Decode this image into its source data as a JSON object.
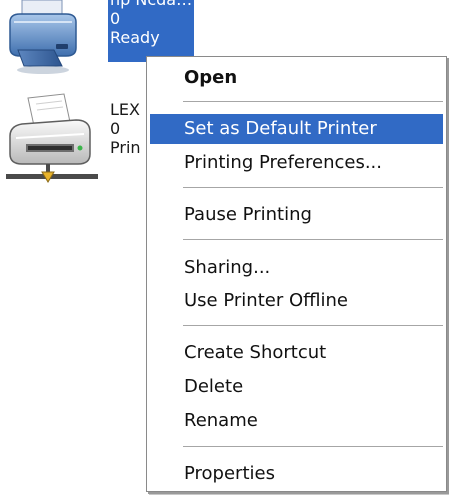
{
  "printers": [
    {
      "name": "hp Ncdá…",
      "jobs": "0",
      "status": "Ready",
      "selected": true,
      "icon": "printer-icon"
    },
    {
      "name": "LEX",
      "jobs": "0",
      "status": "Prin",
      "selected": false,
      "icon": "shared-printer-icon"
    }
  ],
  "menu": {
    "items": [
      {
        "label": "Open",
        "bold": true
      },
      {
        "label": "Set as Default Printer",
        "highlighted": true
      },
      {
        "label": "Printing Preferences..."
      },
      {
        "label": "Pause Printing"
      },
      {
        "label": "Sharing..."
      },
      {
        "label": "Use Printer Offline"
      },
      {
        "label": "Create Shortcut"
      },
      {
        "label": "Delete"
      },
      {
        "label": "Rename"
      },
      {
        "label": "Properties"
      }
    ]
  },
  "colors": {
    "selection": "#316ac5",
    "menu_border": "#8a8a8a",
    "separator": "#a6a6a6"
  }
}
